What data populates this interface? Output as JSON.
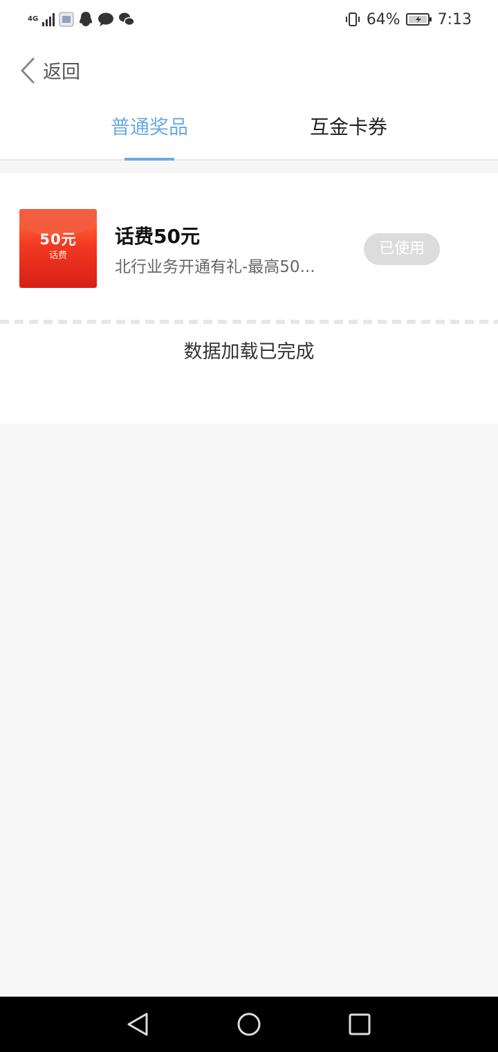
{
  "status_bar": {
    "network_type": "4G",
    "battery_percent": "64%",
    "time": "7:13"
  },
  "header": {
    "back_label": "返回",
    "tabs": [
      {
        "label": "普通奖品",
        "active": true
      },
      {
        "label": "互金卡券",
        "active": false
      }
    ]
  },
  "prizes": [
    {
      "thumbnail_amount": "50元",
      "thumbnail_subtitle": "话费",
      "title": "话费50元",
      "description": "北行业务开通有礼-最高50...",
      "status": "已使用"
    }
  ],
  "list_footer": "数据加载已完成",
  "colors": {
    "accent": "#6aaae6",
    "status_pill": "#dcdcdc",
    "page_background": "#f6f6f6"
  }
}
